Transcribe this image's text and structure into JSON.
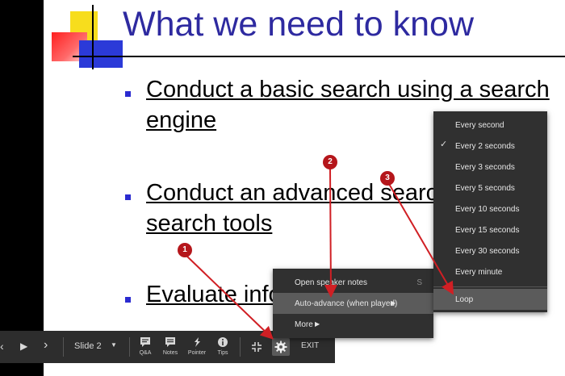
{
  "slide": {
    "title": "What we need to know",
    "bullets": [
      {
        "line1": "Conduct a basic search using a search",
        "line2": "engine"
      },
      {
        "line1": "Conduct an advanced search",
        "line2": "search tools"
      },
      {
        "line1": "Evaluate information"
      }
    ],
    "colors": {
      "title": "#2e2aa0",
      "bullet_marker": "#2b2bd0"
    }
  },
  "toolbar": {
    "slide_label": "Slide 2",
    "tools": [
      {
        "label": "Q&A",
        "icon": "qa-icon"
      },
      {
        "label": "Notes",
        "icon": "notes-icon"
      },
      {
        "label": "Pointer",
        "icon": "pointer-icon"
      },
      {
        "label": "Tips",
        "icon": "info-icon"
      }
    ],
    "exit_label": "EXIT"
  },
  "settings_menu": {
    "items": [
      {
        "label": "Open speaker notes",
        "shortcut": "S"
      },
      {
        "label": "Auto-advance (when played)",
        "highlighted": true
      },
      {
        "label": "More"
      }
    ]
  },
  "auto_advance_menu": {
    "selected": "Every 2 seconds",
    "items": [
      "Every second",
      "Every 2 seconds",
      "Every 3 seconds",
      "Every 5 seconds",
      "Every 10 seconds",
      "Every 15 seconds",
      "Every 30 seconds",
      "Every minute",
      "Loop"
    ]
  },
  "callouts": [
    "1",
    "2",
    "3"
  ]
}
